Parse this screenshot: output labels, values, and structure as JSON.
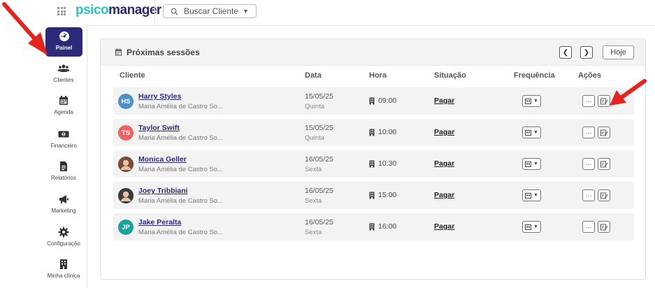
{
  "app": {
    "logo_part1": "psico",
    "logo_part2": "manager"
  },
  "search": {
    "label": "Buscar Cliente"
  },
  "sidebar": {
    "items": [
      {
        "label": "Painel",
        "icon": "dashboard-icon"
      },
      {
        "label": "Clientes",
        "icon": "users-icon"
      },
      {
        "label": "Agenda",
        "icon": "calendar-icon"
      },
      {
        "label": "Financeiro",
        "icon": "money-icon"
      },
      {
        "label": "Relatórios",
        "icon": "report-icon"
      },
      {
        "label": "Marketing",
        "icon": "megaphone-icon"
      },
      {
        "label": "Configuração",
        "icon": "gear-icon"
      },
      {
        "label": "Minha clínica",
        "icon": "building-icon"
      }
    ]
  },
  "panel": {
    "title": "Próximas sessões",
    "today_label": "Hoje",
    "columns": [
      "Cliente",
      "Data",
      "Hora",
      "Situação",
      "Frequência",
      "Ações"
    ]
  },
  "sessions": [
    {
      "initials": "HS",
      "avatar_color": "#4a90c9",
      "name": "Harry Styles",
      "professional": "Maria Amélia de Castro So...",
      "date": "15/05/25",
      "day": "Quinta",
      "time": "09:00",
      "status": "Pagar"
    },
    {
      "initials": "TS",
      "avatar_color": "#f06262",
      "name": "Taylor Swift",
      "professional": "Maria Amélia de Castro So...",
      "date": "15/05/25",
      "day": "Quinta",
      "time": "10:00",
      "status": "Pagar"
    },
    {
      "initials": "",
      "avatar_color": "#7a4b3a",
      "name": "Monica Geller",
      "professional": "Maria Amélia de Castro So...",
      "date": "16/05/25",
      "day": "Sexta",
      "time": "10:30",
      "status": "Pagar"
    },
    {
      "initials": "",
      "avatar_color": "#3b3b3b",
      "name": "Joey Tribbiani",
      "professional": "Maria Amélia de Castro So...",
      "date": "16/05/25",
      "day": "Sexta",
      "time": "15:00",
      "status": "Pagar"
    },
    {
      "initials": "JP",
      "avatar_color": "#1aa39a",
      "name": "Jake Peralta",
      "professional": "Maria Amélia de Castro So...",
      "date": "16/05/25",
      "day": "Sexta",
      "time": "16:00",
      "status": "Pagar"
    }
  ],
  "colors": {
    "primary": "#2b2a7b",
    "accent": "#2ec4b6",
    "annotation": "#e52420"
  }
}
